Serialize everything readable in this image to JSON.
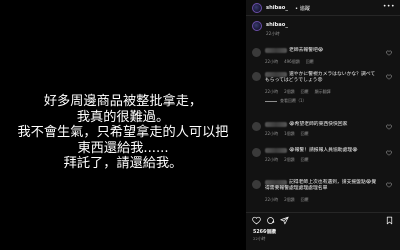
{
  "post": {
    "lines": [
      "好多周邊商品被整批拿走，",
      "我真的很難過。",
      "我不會生氣，只希望拿走的人可以把",
      "東西還給我......",
      "拜託了，請還給我。"
    ]
  },
  "header": {
    "username": "shibao_",
    "follow_label": "• 追蹤",
    "more": "•••"
  },
  "caption": {
    "username": "shibao_",
    "timestamp": "22小時"
  },
  "comments": [
    {
      "text": "老師去報警吧😭",
      "meta": [
        "22小時",
        "496個讚",
        "回覆"
      ]
    },
    {
      "text": "速やかに警視カメラはないかな？調べてもらってはどうでしょう😟",
      "meta": [
        "22小時",
        "2個讚",
        "回覆",
        "顯示翻譯"
      ],
      "replies": "查看回覆（1）"
    },
    {
      "text": "😭希望老師的東西快快回家",
      "meta": [
        "22小時",
        "1個讚",
        "回覆"
      ]
    },
    {
      "text": "😭報警！請报報人員協助處理😭",
      "meta": [
        "22小時",
        "2個讚",
        "回覆"
      ]
    },
    {
      "text": "記得老師上次也有遇到，請支援盤點😭覺得需要報警處理處理處理名單",
      "meta": [
        "22小時",
        "2個讚",
        "回覆"
      ]
    }
  ],
  "footer": {
    "likes": "5266個讚",
    "time": "22小時"
  },
  "icons": {
    "heart": "heart-icon",
    "comment": "comment-icon",
    "share": "share-icon",
    "save": "bookmark-icon"
  }
}
